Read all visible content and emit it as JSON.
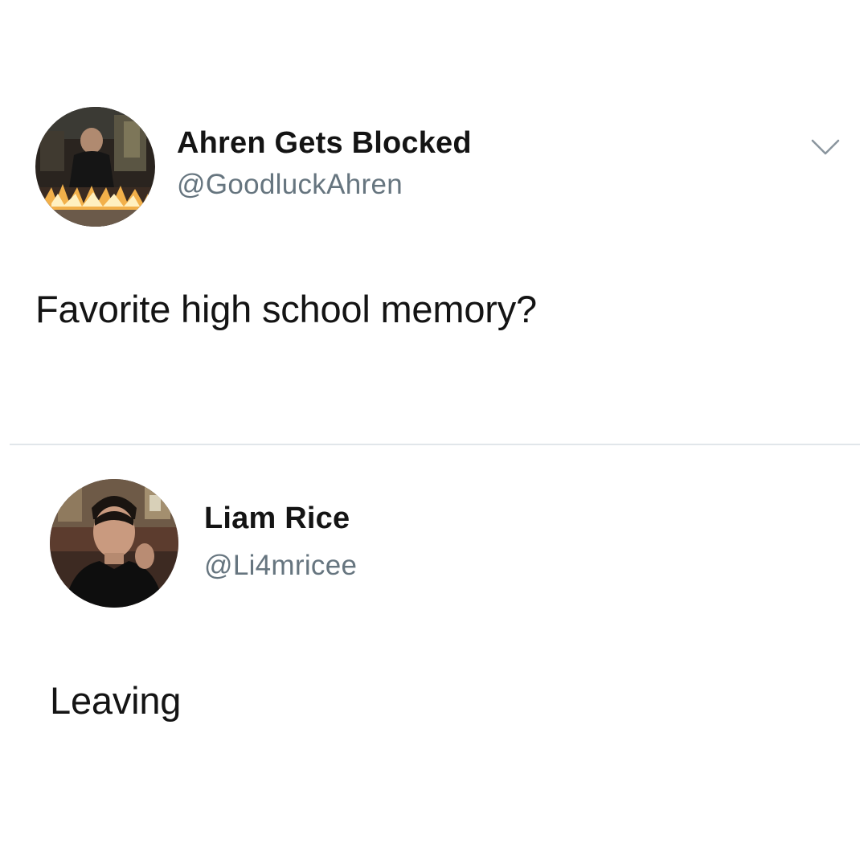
{
  "tweets": [
    {
      "display_name": "Ahren Gets Blocked",
      "handle": "@GoodluckAhren",
      "text": "Favorite high school memory?"
    },
    {
      "display_name": "Liam Rice",
      "handle": "@Li4mricee",
      "text": "Leaving"
    }
  ],
  "icons": {
    "menu": "chevron-down-icon"
  },
  "colors": {
    "handle": "#66757f",
    "divider": "#e1e6ea",
    "background": "#ffffff"
  }
}
